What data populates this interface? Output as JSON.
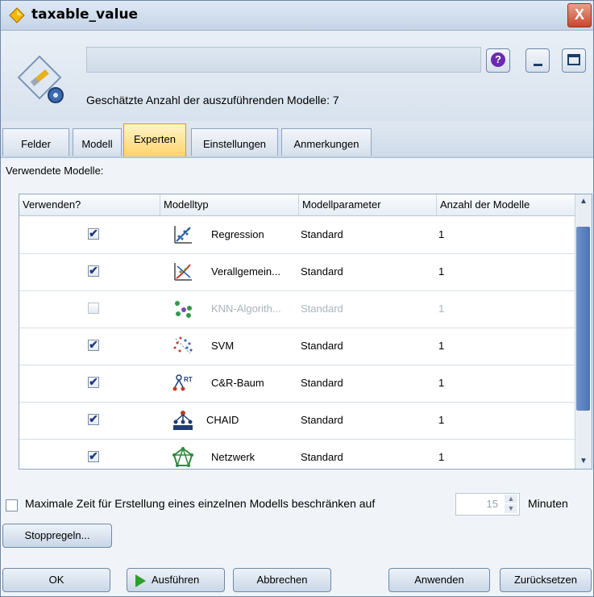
{
  "window": {
    "title": "taxable_value",
    "close_label": "X"
  },
  "header": {
    "name_value": "",
    "help_label": "?",
    "estimate_text": "Geschätzte Anzahl der auszuführenden Modelle: 7"
  },
  "tabs": [
    {
      "label": "Felder",
      "active": false
    },
    {
      "label": "Modell",
      "active": false
    },
    {
      "label": "Experten",
      "active": true
    },
    {
      "label": "Einstellungen",
      "active": false
    },
    {
      "label": "Anmerkungen",
      "active": false
    }
  ],
  "section_label": "Verwendete Modelle:",
  "table": {
    "columns": [
      "Verwenden?",
      "Modelltyp",
      "Modellparameter",
      "Anzahl der Modelle"
    ],
    "rows": [
      {
        "use": true,
        "icon": "regression-icon",
        "type": "Regression",
        "params": "Standard",
        "count": "1",
        "enabled": true
      },
      {
        "use": true,
        "icon": "genlin-icon",
        "type": "Verallgemein...",
        "params": "Standard",
        "count": "1",
        "enabled": true
      },
      {
        "use": false,
        "icon": "knn-icon",
        "type": "KNN-Algorith...",
        "params": "Standard",
        "count": "1",
        "enabled": false
      },
      {
        "use": true,
        "icon": "svm-icon",
        "type": "SVM",
        "params": "Standard",
        "count": "1",
        "enabled": true
      },
      {
        "use": true,
        "icon": "crt-icon",
        "type": "C&R-Baum",
        "params": "Standard",
        "count": "1",
        "enabled": true
      },
      {
        "use": true,
        "icon": "chaid-icon",
        "type": "CHAID",
        "params": "Standard",
        "count": "1",
        "enabled": true
      },
      {
        "use": true,
        "icon": "network-icon",
        "type": "Netzwerk",
        "params": "Standard",
        "count": "1",
        "enabled": true
      }
    ]
  },
  "max_time": {
    "checked": false,
    "label": "Maximale Zeit für Erstellung eines einzelnen Modells beschränken auf",
    "value": "15",
    "unit": "Minuten"
  },
  "buttons": {
    "stop_rules": "Stoppregeln...",
    "ok": "OK",
    "run": "Ausführen",
    "cancel": "Abbrechen",
    "apply": "Anwenden",
    "reset": "Zurücksetzen"
  }
}
